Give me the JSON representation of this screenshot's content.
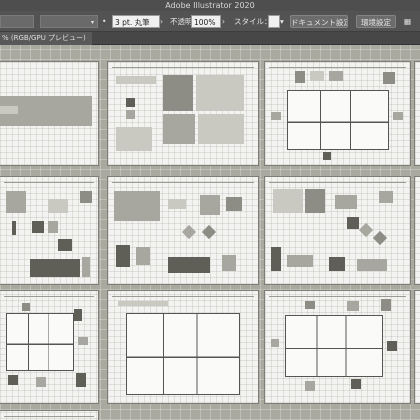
{
  "app": {
    "title": "Adobe Illustrator 2020"
  },
  "control_bar": {
    "stroke_weight": "3 pt. 丸筆",
    "opacity_label": "不透明度：",
    "opacity_value": "100%",
    "style_label": "スタイル：",
    "document_settings": "ドキュメント設定",
    "preferences": "環境設定"
  },
  "document_tab": {
    "label": "% (RGB/GPU プレビュー)"
  },
  "colors": {
    "ui_dark": "#535353",
    "canvas": "#a9a9a0",
    "artboard": "#f3f3f1"
  },
  "icons": [
    "dropdown-arrow-icon",
    "stroke-style-icon",
    "chevron-down-icon"
  ]
}
